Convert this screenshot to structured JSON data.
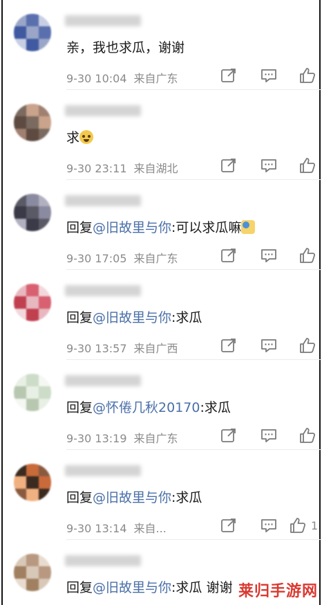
{
  "comments": [
    {
      "text": "亲，我也求瓜，谢谢",
      "mention": "",
      "suffix": "",
      "emoji": "",
      "time": "9-30 10:04",
      "location": "来自广东",
      "likes": ""
    },
    {
      "text": "求",
      "mention": "",
      "suffix": "",
      "emoji": "cry",
      "time": "9-30 23:11",
      "location": "来自湖北",
      "likes": ""
    },
    {
      "text": "回复",
      "mention": "@旧故里与你",
      "suffix": ":可以求瓜嘛",
      "emoji": "face",
      "time": "9-30 17:05",
      "location": "来自广东",
      "likes": ""
    },
    {
      "text": "回复",
      "mention": "@旧故里与你",
      "suffix": ":求瓜",
      "emoji": "",
      "time": "9-30 13:57",
      "location": "来自广西",
      "likes": ""
    },
    {
      "text": "回复",
      "mention": "@怀倦几秋20170",
      "suffix": ":求瓜",
      "emoji": "",
      "time": "9-30 13:19",
      "location": "来自广东",
      "likes": ""
    },
    {
      "text": "回复",
      "mention": "@旧故里与你",
      "suffix": ":求瓜",
      "emoji": "",
      "time": "9-30 13:14",
      "location": "来自...",
      "likes": "1"
    },
    {
      "text": "回复",
      "mention": "@旧故里与你",
      "suffix": ":求瓜  谢谢",
      "emoji": "",
      "time": "",
      "location": "",
      "likes": ""
    }
  ],
  "icons": {
    "share": "share-icon",
    "comment": "comment-icon",
    "like": "like-icon"
  },
  "watermark": {
    "text": "莱归手游网"
  },
  "colors": {
    "mention": "#4a6fa8",
    "meta": "#8a8a8a",
    "watermark": "#d6241b"
  }
}
